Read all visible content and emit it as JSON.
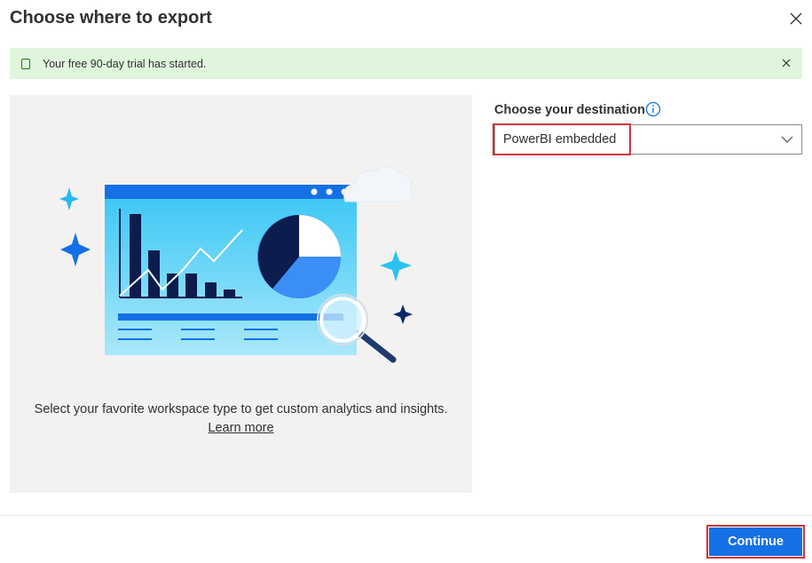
{
  "dialog": {
    "title": "Choose where to export",
    "close_icon": "close-icon"
  },
  "banner": {
    "icon": "phone-icon",
    "text": "Your free 90-day trial has started.",
    "dismiss_icon": "close-icon"
  },
  "illustration": {
    "icon": "analytics-dashboard-illustration",
    "description": "Select your favorite workspace type to get custom analytics and insights.",
    "learn_more": "Learn more"
  },
  "destination": {
    "label": "Choose your destination",
    "info_icon": "info-icon",
    "selected": "PowerBI embedded",
    "chevron_icon": "chevron-down-icon"
  },
  "footer": {
    "continue_label": "Continue"
  },
  "colors": {
    "accent": "#1570e6",
    "banner_bg": "#dff6dd",
    "highlight": "#d13438",
    "panel_bg": "#f3f2f1"
  }
}
